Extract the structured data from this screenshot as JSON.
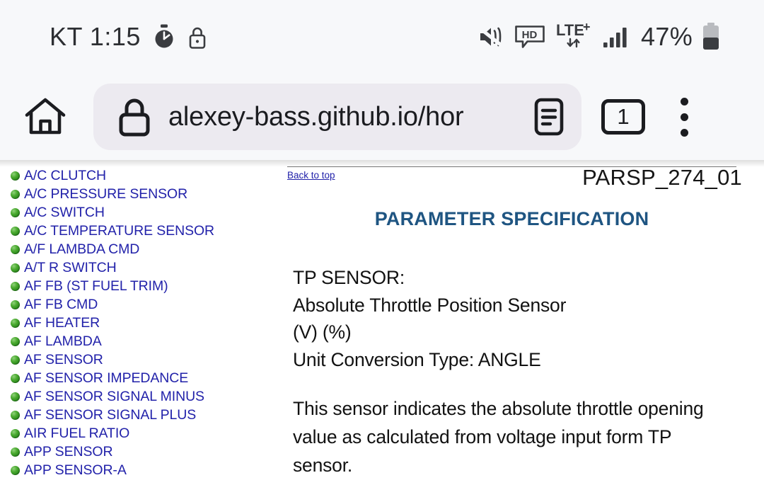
{
  "statusbar": {
    "carrier_time": "KT 1:15",
    "icons_left": [
      "stopwatch-icon",
      "lock-icon"
    ],
    "icons_right": [
      "mute-vibrate-icon",
      "hd-icon",
      "lte-plus-icon",
      "signal-bars-icon"
    ],
    "network": "LTE",
    "network_plus": "+",
    "hd_label": "HD",
    "battery_percent": "47%"
  },
  "toolbar": {
    "home_label": "home-icon",
    "url": "alexey-bass.github.io/hor",
    "reader_label": "reader-mode-icon",
    "tab_count": "1",
    "menu_label": "more-options-icon"
  },
  "sidebar": {
    "items": [
      {
        "label": "A/C CLUTCH"
      },
      {
        "label": "A/C PRESSURE SENSOR"
      },
      {
        "label": "A/C SWITCH"
      },
      {
        "label": "A/C TEMPERATURE SENSOR"
      },
      {
        "label": "A/F LAMBDA CMD"
      },
      {
        "label": "A/T R SWITCH"
      },
      {
        "label": "AF FB (ST FUEL TRIM)"
      },
      {
        "label": "AF FB CMD"
      },
      {
        "label": "AF HEATER"
      },
      {
        "label": "AF LAMBDA"
      },
      {
        "label": "AF SENSOR"
      },
      {
        "label": "AF SENSOR IMPEDANCE"
      },
      {
        "label": "AF SENSOR SIGNAL MINUS"
      },
      {
        "label": "AF SENSOR SIGNAL PLUS"
      },
      {
        "label": "AIR FUEL RATIO"
      },
      {
        "label": "APP SENSOR"
      },
      {
        "label": "APP SENSOR-A"
      }
    ]
  },
  "content": {
    "back_to_top": "Back to top",
    "doc_id": "PARSP_274_01",
    "spec_title": "PARAMETER SPECIFICATION",
    "lines": [
      "TP SENSOR:",
      "Absolute Throttle Position Sensor",
      "(V) (%)",
      "Unit Conversion Type: ANGLE"
    ],
    "paragraph": "This sensor indicates the absolute throttle opening value as calculated from voltage input form TP sensor."
  },
  "colors": {
    "link_blue": "#2222aa",
    "heading_blue": "#1f5582",
    "bullet_green": "#2a8a1c",
    "chrome_bg": "#f7f8fa",
    "urlbar_bg": "#eceaf0"
  }
}
